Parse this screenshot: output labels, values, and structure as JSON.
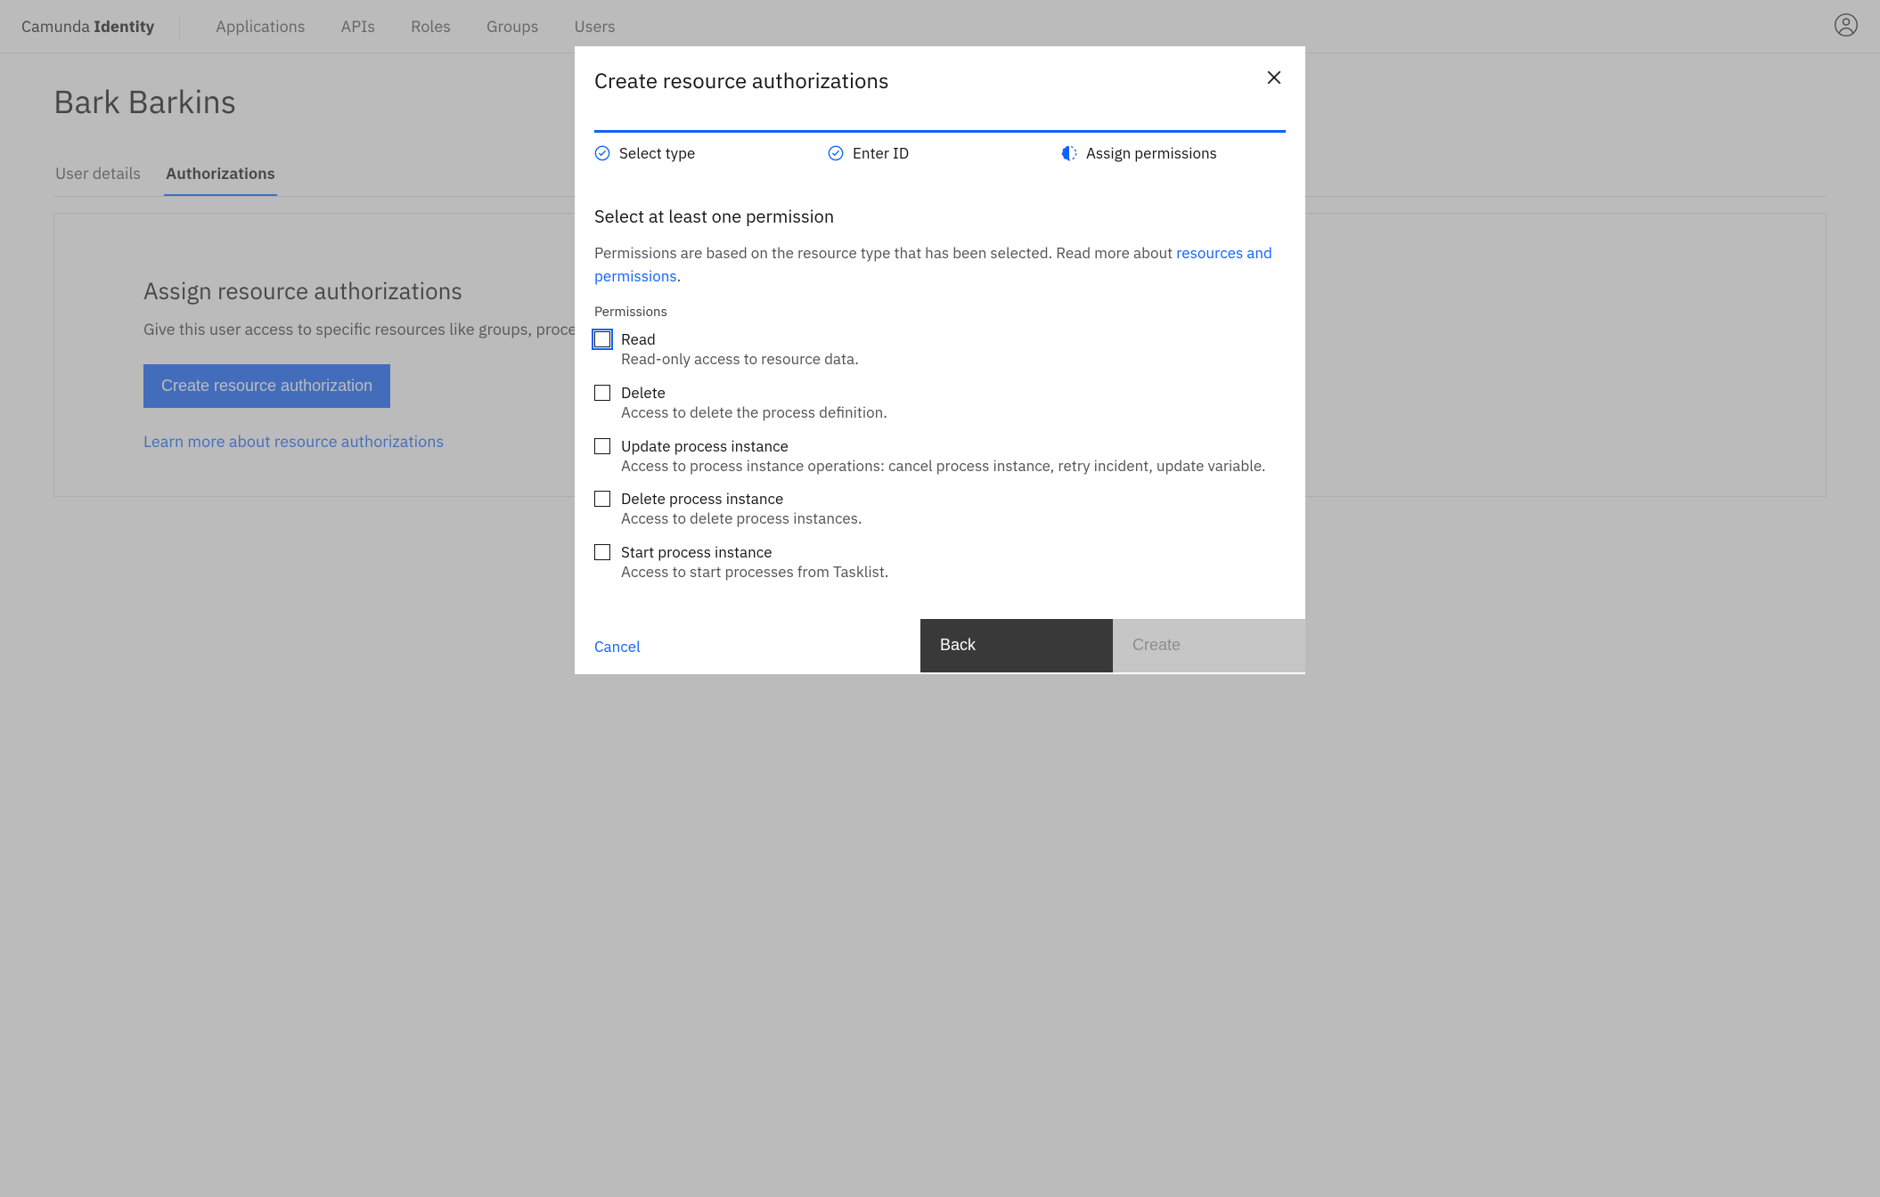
{
  "header": {
    "brand_light": "Camunda ",
    "brand_bold": "Identity",
    "nav": [
      "Applications",
      "APIs",
      "Roles",
      "Groups",
      "Users"
    ]
  },
  "page": {
    "title": "Bark Barkins",
    "tabs": [
      {
        "label": "User details",
        "active": false
      },
      {
        "label": "Authorizations",
        "active": true
      }
    ],
    "panel": {
      "heading": "Assign resource authorizations",
      "description": "Give this user access to specific resources like groups, process definitions, and decision definitions.",
      "button": "Create resource authorization",
      "learn_more": "Learn more about resource authorizations"
    }
  },
  "modal": {
    "title": "Create resource authorizations",
    "steps": [
      {
        "label": "Select type",
        "state": "done"
      },
      {
        "label": "Enter ID",
        "state": "done"
      },
      {
        "label": "Assign permissions",
        "state": "current"
      }
    ],
    "section_title": "Select at least one permission",
    "section_desc_pre": "Permissions are based on the resource type that has been selected. Read more about ",
    "section_desc_link": "resources and permissions",
    "section_desc_post": ".",
    "field_label": "Permissions",
    "permissions": [
      {
        "label": "Read",
        "desc": "Read-only access to resource data.",
        "focused": true
      },
      {
        "label": "Delete",
        "desc": "Access to delete the process definition.",
        "focused": false
      },
      {
        "label": "Update process instance",
        "desc": "Access to process instance operations: cancel process instance, retry incident, update variable.",
        "focused": false
      },
      {
        "label": "Delete process instance",
        "desc": "Access to delete process instances.",
        "focused": false
      },
      {
        "label": "Start process instance",
        "desc": "Access to start processes from Tasklist.",
        "focused": false
      }
    ],
    "footer": {
      "cancel": "Cancel",
      "back": "Back",
      "create": "Create"
    }
  }
}
